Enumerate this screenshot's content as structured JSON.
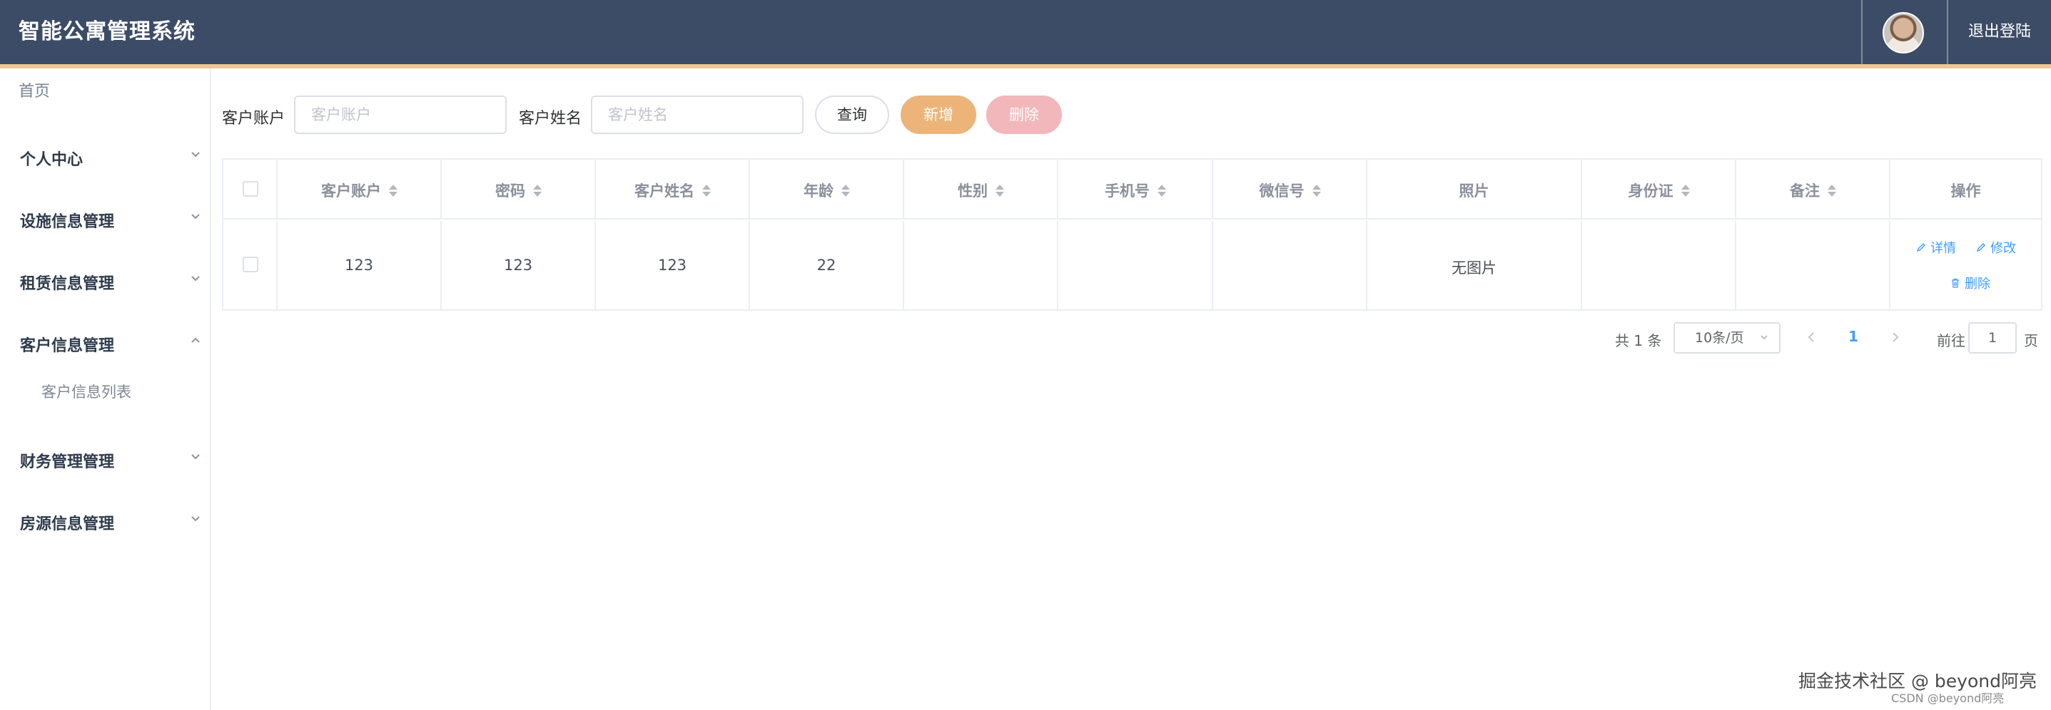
{
  "header": {
    "title": "智能公寓管理系统",
    "logout_label": "退出登陆"
  },
  "sidebar": {
    "home_label": "首页",
    "items": [
      {
        "label": "个人中心",
        "expanded": false
      },
      {
        "label": "设施信息管理",
        "expanded": false
      },
      {
        "label": "租赁信息管理",
        "expanded": false
      },
      {
        "label": "客户信息管理",
        "expanded": true
      },
      {
        "label": "财务管理管理",
        "expanded": false
      },
      {
        "label": "房源信息管理",
        "expanded": false
      }
    ],
    "sub_items": [
      {
        "label": "客户信息列表"
      }
    ]
  },
  "search": {
    "account_label": "客户账户",
    "account_placeholder": "客户账户",
    "account_value": "",
    "name_label": "客户姓名",
    "name_placeholder": "客户姓名",
    "name_value": "",
    "query_label": "查询",
    "add_label": "新增",
    "delete_label": "删除"
  },
  "table": {
    "columns": [
      "客户账户",
      "密码",
      "客户姓名",
      "年龄",
      "性别",
      "手机号",
      "微信号",
      "照片",
      "身份证",
      "备注",
      "操作"
    ],
    "rows": [
      {
        "account": "123",
        "password": "123",
        "name": "123",
        "age": "22",
        "gender": "",
        "phone": "",
        "wechat": "",
        "photo": "无图片",
        "id_card": "",
        "remark": ""
      }
    ],
    "actions": {
      "detail": "详情",
      "edit": "修改",
      "delete": "删除"
    }
  },
  "pagination": {
    "total_text": "共 1 条",
    "page_size": "10条/页",
    "current_page": "1",
    "goto_label": "前往",
    "goto_value": "1",
    "page_suffix": "页"
  },
  "watermark": {
    "line1": "掘金技术社区 @ beyond阿亮",
    "line2": "CSDN @beyond阿亮"
  },
  "colors": {
    "header_bg": "#3d4c66",
    "header_accent": "#f0c594",
    "add_button": "#ecb478",
    "delete_button": "#f2b7bb",
    "link": "#409eff"
  }
}
